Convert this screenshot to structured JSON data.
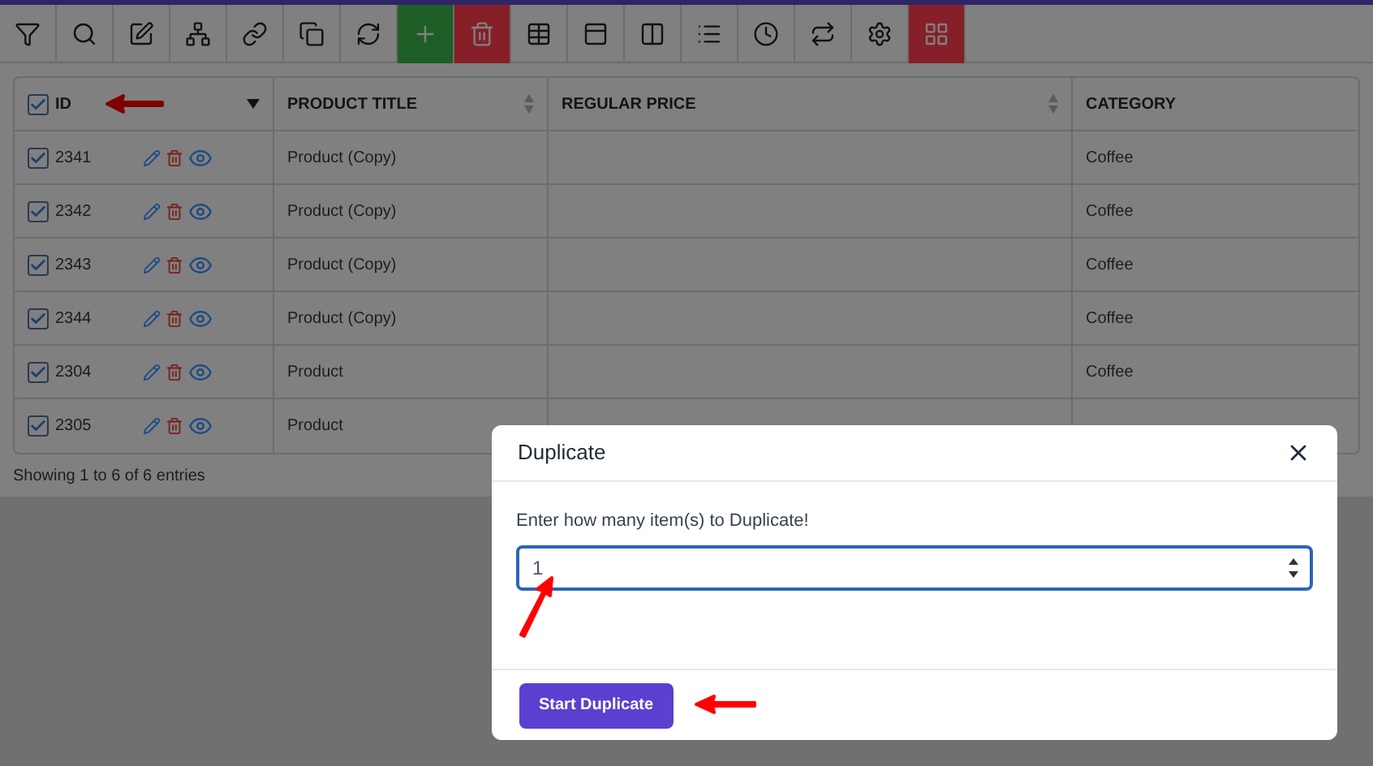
{
  "toolbar": {
    "buttons": [
      {
        "kind": "plain"
      },
      {
        "kind": "plain"
      },
      {
        "kind": "plain"
      },
      {
        "kind": "plain"
      },
      {
        "kind": "plain"
      },
      {
        "kind": "plain"
      },
      {
        "kind": "plain"
      },
      {
        "kind": "accent",
        "color": "#1e5e26"
      },
      {
        "kind": "accent",
        "color": "#861f27"
      },
      {
        "kind": "plain"
      },
      {
        "kind": "plain"
      },
      {
        "kind": "plain"
      },
      {
        "kind": "plain"
      },
      {
        "kind": "plain"
      },
      {
        "kind": "plain"
      },
      {
        "kind": "plain"
      },
      {
        "kind": "accent",
        "color": "#861f27"
      }
    ]
  },
  "table": {
    "select_all": {
      "checked": true
    },
    "columns": [
      {
        "label": "ID",
        "kind": "sorted"
      },
      {
        "label": "PRODUCT TITLE",
        "kind": "sortable"
      },
      {
        "label": "REGULAR PRICE",
        "kind": "sortable"
      },
      {
        "label": "CATEGORY",
        "kind": "plain"
      }
    ],
    "rows": [
      {
        "checked": true,
        "id": "2341",
        "title": "Product (Copy)",
        "category": "Coffee"
      },
      {
        "checked": true,
        "id": "2342",
        "title": "Product (Copy)",
        "category": "Coffee"
      },
      {
        "checked": true,
        "id": "2343",
        "title": "Product (Copy)",
        "category": "Coffee"
      },
      {
        "checked": true,
        "id": "2344",
        "title": "Product (Copy)",
        "category": "Coffee"
      },
      {
        "checked": true,
        "id": "2304",
        "title": "Product",
        "category": "Coffee"
      },
      {
        "checked": true,
        "id": "2305",
        "title": "Product"
      }
    ],
    "footer": "Showing 1 to 6 of 6 entries"
  },
  "dialog": {
    "title": "Duplicate",
    "label": "Enter how many item(s) to Duplicate!",
    "value": "1",
    "button": "Start Duplicate"
  }
}
